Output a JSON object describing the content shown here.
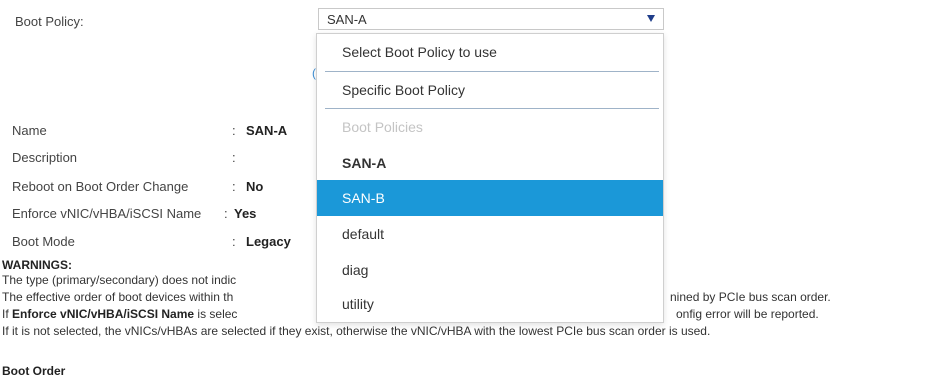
{
  "boot_policy": {
    "label": "Boot Policy:",
    "selected_value": "SAN-A",
    "icon": "chevron-down-icon"
  },
  "details": {
    "name": {
      "label": "Name",
      "colon": ":",
      "value": "SAN-A"
    },
    "description": {
      "label": "Description",
      "colon": ":",
      "value": ""
    },
    "reboot": {
      "label": "Reboot on Boot Order Change",
      "colon": ":",
      "value": "No"
    },
    "enforce": {
      "label": "Enforce vNIC/vHBA/iSCSI Name",
      "colon": ":",
      "value": "Yes"
    },
    "boot_mode": {
      "label": "Boot Mode",
      "colon": ":",
      "value": "Legacy"
    }
  },
  "stray_glyph": "(",
  "warnings": {
    "title": "WARNINGS:",
    "line1": "The type (primary/secondary) does not indic",
    "line2": "The effective order of boot devices within th",
    "line2_tail": "nined by PCIe bus scan order.",
    "line3_prefix": "If ",
    "line3_bold": "Enforce vNIC/vHBA/iSCSI Name",
    "line3_mid": " is selec",
    "line3_tail": "onfig error will be reported.",
    "line4": "If it is not selected, the vNICs/vHBAs are selected if they exist, otherwise the vNIC/vHBA with the lowest PCIe bus scan order is used."
  },
  "boot_order_title": "Boot Order",
  "dropdown": {
    "options": [
      {
        "label": "Select Boot Policy to use",
        "kind": "option"
      },
      {
        "label": "Specific Boot Policy",
        "kind": "option"
      },
      {
        "label": "Boot Policies",
        "kind": "heading"
      },
      {
        "label": "SAN-A",
        "kind": "current"
      },
      {
        "label": "SAN-B",
        "kind": "highlighted"
      },
      {
        "label": "default",
        "kind": "option"
      },
      {
        "label": "diag",
        "kind": "option"
      },
      {
        "label": "utility",
        "kind": "option"
      }
    ]
  },
  "colors": {
    "highlight": "#1b98d8",
    "arrow": "#1f3d8a",
    "divider": "#9fb3c8"
  }
}
